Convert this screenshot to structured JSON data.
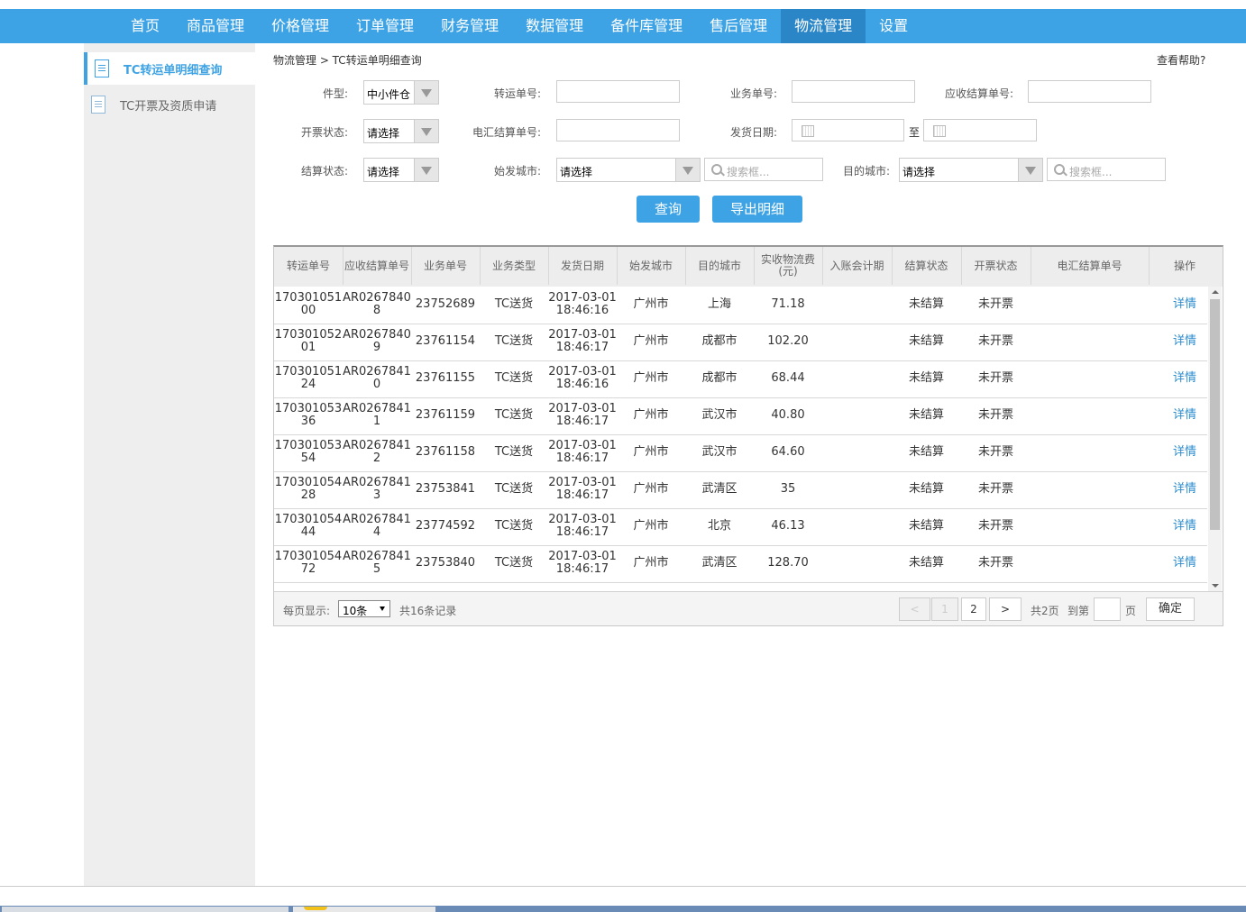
{
  "nav": {
    "items": [
      "首页",
      "商品管理",
      "价格管理",
      "订单管理",
      "财务管理",
      "数据管理",
      "备件库管理",
      "售后管理",
      "物流管理",
      "设置"
    ],
    "active_index": 8
  },
  "sidebar": {
    "items": [
      {
        "label": "TC转运单明细查询",
        "active": true
      },
      {
        "label": "TC开票及资质申请",
        "active": false
      }
    ]
  },
  "breadcrumb": "物流管理 > TC转运单明细查询",
  "help": "查看帮助?",
  "filters": {
    "type_label": "件型:",
    "type_value": "中小件仓",
    "transfer_no_label": "转运单号:",
    "transfer_no_value": "",
    "biz_no_label": "业务单号:",
    "biz_no_value": "",
    "receivable_no_label": "应收结算单号:",
    "receivable_no_value": "",
    "invoice_status_label": "开票状态:",
    "invoice_status_value": "请选择",
    "wire_no_label": "电汇结算单号:",
    "wire_no_value": "",
    "ship_date_label": "发货日期:",
    "to_label": "至",
    "settle_status_label": "结算状态:",
    "settle_status_value": "请选择",
    "origin_label": "始发城市:",
    "origin_value": "请选择",
    "origin_search_placeholder": "搜索框...",
    "dest_label": "目的城市:",
    "dest_value": "请选择",
    "dest_search_placeholder": "搜索框..."
  },
  "buttons": {
    "query": "查询",
    "export": "导出明细"
  },
  "table": {
    "headers": [
      "转运单号",
      "应收结算单号",
      "业务单号",
      "业务类型",
      "发货日期",
      "始发城市",
      "目的城市",
      "实收物流费(元)",
      "入账会计期",
      "结算状态",
      "开票状态",
      "电汇结算单号",
      "操作"
    ],
    "rows": [
      {
        "transfer_no": "17030105100",
        "receivable_no": "AR02678408",
        "biz_no": "23752689",
        "biz_type": "TC送货",
        "ship_date": "2017-03-01",
        "ship_time": "18:46:16",
        "origin": "广州市",
        "dest": "上海",
        "fee": "71.18",
        "period": "",
        "settle": "未结算",
        "invoice": "未开票",
        "wire": "",
        "action": "详情"
      },
      {
        "transfer_no": "17030105201",
        "receivable_no": "AR02678409",
        "biz_no": "23761154",
        "biz_type": "TC送货",
        "ship_date": "2017-03-01",
        "ship_time": "18:46:17",
        "origin": "广州市",
        "dest": "成都市",
        "fee": "102.20",
        "period": "",
        "settle": "未结算",
        "invoice": "未开票",
        "wire": "",
        "action": "详情"
      },
      {
        "transfer_no": "17030105124",
        "receivable_no": "AR02678410",
        "biz_no": "23761155",
        "biz_type": "TC送货",
        "ship_date": "2017-03-01",
        "ship_time": "18:46:16",
        "origin": "广州市",
        "dest": "成都市",
        "fee": "68.44",
        "period": "",
        "settle": "未结算",
        "invoice": "未开票",
        "wire": "",
        "action": "详情"
      },
      {
        "transfer_no": "17030105336",
        "receivable_no": "AR02678411",
        "biz_no": "23761159",
        "biz_type": "TC送货",
        "ship_date": "2017-03-01",
        "ship_time": "18:46:17",
        "origin": "广州市",
        "dest": "武汉市",
        "fee": "40.80",
        "period": "",
        "settle": "未结算",
        "invoice": "未开票",
        "wire": "",
        "action": "详情"
      },
      {
        "transfer_no": "17030105354",
        "receivable_no": "AR02678412",
        "biz_no": "23761158",
        "biz_type": "TC送货",
        "ship_date": "2017-03-01",
        "ship_time": "18:46:17",
        "origin": "广州市",
        "dest": "武汉市",
        "fee": "64.60",
        "period": "",
        "settle": "未结算",
        "invoice": "未开票",
        "wire": "",
        "action": "详情"
      },
      {
        "transfer_no": "17030105428",
        "receivable_no": "AR02678413",
        "biz_no": "23753841",
        "biz_type": "TC送货",
        "ship_date": "2017-03-01",
        "ship_time": "18:46:17",
        "origin": "广州市",
        "dest": "武清区",
        "fee": "35",
        "period": "",
        "settle": "未结算",
        "invoice": "未开票",
        "wire": "",
        "action": "详情"
      },
      {
        "transfer_no": "17030105444",
        "receivable_no": "AR02678414",
        "biz_no": "23774592",
        "biz_type": "TC送货",
        "ship_date": "2017-03-01",
        "ship_time": "18:46:17",
        "origin": "广州市",
        "dest": "北京",
        "fee": "46.13",
        "period": "",
        "settle": "未结算",
        "invoice": "未开票",
        "wire": "",
        "action": "详情"
      },
      {
        "transfer_no": "17030105472",
        "receivable_no": "AR02678415",
        "biz_no": "23753840",
        "biz_type": "TC送货",
        "ship_date": "2017-03-01",
        "ship_time": "18:46:17",
        "origin": "广州市",
        "dest": "武清区",
        "fee": "128.70",
        "period": "",
        "settle": "未结算",
        "invoice": "未开票",
        "wire": "",
        "action": "详情"
      }
    ]
  },
  "pager": {
    "per_page_label": "每页显示:",
    "per_page_value": "10条",
    "total_label": "共16条记录",
    "prev": "<",
    "page1": "1",
    "page2": "2",
    "next": ">",
    "total_pages": "共2页",
    "goto_label": "到第",
    "goto_value": "",
    "page_suffix": "页",
    "confirm": "确定"
  }
}
